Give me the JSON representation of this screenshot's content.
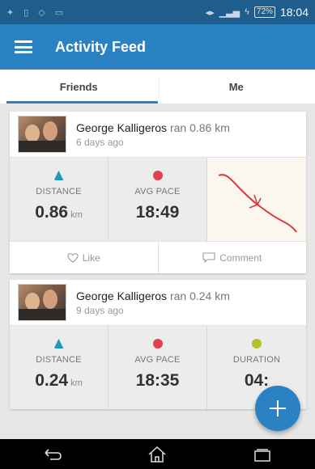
{
  "status_bar": {
    "battery": "72%",
    "time": "18:04"
  },
  "app_bar": {
    "title": "Activity Feed"
  },
  "tabs": [
    {
      "label": "Friends",
      "active": true
    },
    {
      "label": "Me",
      "active": false
    }
  ],
  "feed": [
    {
      "actor": "George Kalligeros",
      "verb": "ran 0.86 km",
      "time_ago": "6 days ago",
      "stats": [
        {
          "icon": "distance-icon",
          "label": "DISTANCE",
          "value": "0.86",
          "unit": "km"
        },
        {
          "icon": "pace-icon",
          "label": "AVG PACE",
          "value": "18:49",
          "unit": ""
        }
      ],
      "like_label": "Like",
      "comment_label": "Comment"
    },
    {
      "actor": "George Kalligeros",
      "verb": "ran 0.24 km",
      "time_ago": "9 days ago",
      "stats": [
        {
          "icon": "distance-icon",
          "label": "DISTANCE",
          "value": "0.24",
          "unit": "km"
        },
        {
          "icon": "pace-icon",
          "label": "AVG PACE",
          "value": "18:35",
          "unit": ""
        },
        {
          "icon": "duration-icon",
          "label": "DURATION",
          "value": "04:",
          "unit": ""
        }
      ]
    }
  ],
  "colors": {
    "primary": "#2a82c3",
    "status_bar": "#1f5d8d",
    "route_line": "#d8393f"
  }
}
